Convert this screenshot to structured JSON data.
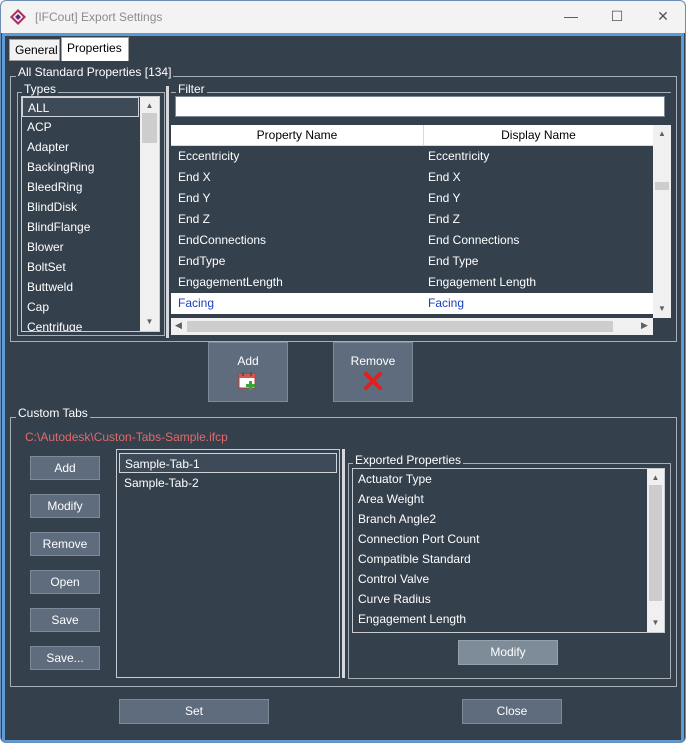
{
  "window": {
    "title": "[IFCout] Export Settings",
    "minimize": "—",
    "maximize": "☐",
    "close": "✕"
  },
  "tabs": [
    {
      "label": "General",
      "active": false
    },
    {
      "label": "Properties",
      "active": true
    }
  ],
  "standard": {
    "group_label": "All Standard Properties [134]",
    "types_label": "Types",
    "types": [
      "ALL",
      "ACP",
      "Adapter",
      "BackingRing",
      "BleedRing",
      "BlindDisk",
      "BlindFlange",
      "Blower",
      "BoltSet",
      "Buttweld",
      "Cap",
      "Centrifuge"
    ],
    "selected_type": "ALL",
    "filter_label": "Filter",
    "filter_value": "",
    "columns": [
      "Property Name",
      "Display Name"
    ],
    "rows": [
      {
        "name": "Eccentricity",
        "display": "Eccentricity"
      },
      {
        "name": "End X",
        "display": "End X"
      },
      {
        "name": "End Y",
        "display": "End Y"
      },
      {
        "name": "End Z",
        "display": "End Z"
      },
      {
        "name": "EndConnections",
        "display": "End Connections"
      },
      {
        "name": "EndType",
        "display": "End Type"
      },
      {
        "name": "EngagementLength",
        "display": "Engagement Length"
      },
      {
        "name": "Facing",
        "display": "Facing"
      }
    ],
    "selected_row": "Facing",
    "add_label": "Add",
    "remove_label": "Remove"
  },
  "custom": {
    "group_label": "Custom Tabs",
    "file_path": "C:\\Autodesk\\Custon-Tabs-Sample.ifcp",
    "buttons": [
      "Add",
      "Modify",
      "Remove",
      "Open",
      "Save",
      "Save..."
    ],
    "tabs": [
      "Sample-Tab-1",
      "Sample-Tab-2"
    ],
    "selected_tab": "Sample-Tab-1",
    "exported_label": "Exported Properties",
    "exported": [
      "Actuator Type",
      "Area Weight",
      "Branch Angle2",
      "Connection Port Count",
      "Compatible Standard",
      "Control Valve",
      "Curve Radius",
      "Engagement Length"
    ],
    "modify_label": "Modify"
  },
  "footer": {
    "set_label": "Set",
    "close_label": "Close"
  },
  "colors": {
    "background": "#35404d",
    "accent_border": "#5c9bd8",
    "path_text": "#e26a6a",
    "remove_icon": "#e02020"
  }
}
